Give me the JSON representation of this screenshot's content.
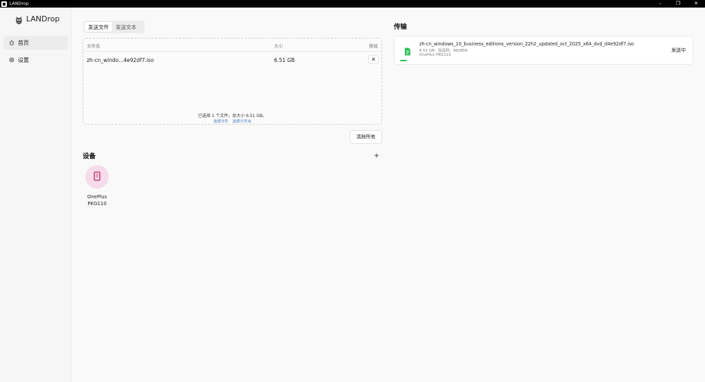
{
  "window": {
    "title": "LANDrop",
    "minimize": "–",
    "maximize": "❐",
    "close": "✕"
  },
  "brand": {
    "name": "LANDrop"
  },
  "nav": {
    "home": "首页",
    "settings": "设置"
  },
  "send_tabs": {
    "files": "发送文件",
    "text": "发送文本",
    "active": "发送文件"
  },
  "file_table": {
    "headers": {
      "name": "文件名",
      "size": "大小",
      "remove": "移除"
    },
    "rows": [
      {
        "name": "zh-cn_windo...4e92df7.iso",
        "size": "6.51 GB",
        "remove": "✕"
      }
    ],
    "summary": "已选择 1 个文件，总大小 6.51 GB。",
    "select_files": "选择文件",
    "select_folder": "选择文件夹"
  },
  "clear_all": "清除所有",
  "devices": {
    "title": "设备",
    "add": "+",
    "items": [
      {
        "name_line1": "OnePlus",
        "name_line2": "PKG110"
      }
    ]
  },
  "transfer": {
    "title": "传输",
    "items": [
      {
        "filename": "zh-cn_windows_10_business_editions_version_22h2_updated_oct_2025_x64_dvd_d4e92df7.iso",
        "meta": "6.51 GB · 验证码：962856",
        "device": "OnePlus PKG110",
        "status": "发送中",
        "progress": 0.02
      }
    ]
  },
  "colors": {
    "accent_green": "#2fbf5a",
    "device_circle": "#f6dcea",
    "device_phone": "#c2186a",
    "link_blue": "#4a7cc4"
  },
  "icons": {
    "home": "home-icon",
    "settings": "settings-icon",
    "file": "file-icon",
    "phone": "phone-icon"
  }
}
